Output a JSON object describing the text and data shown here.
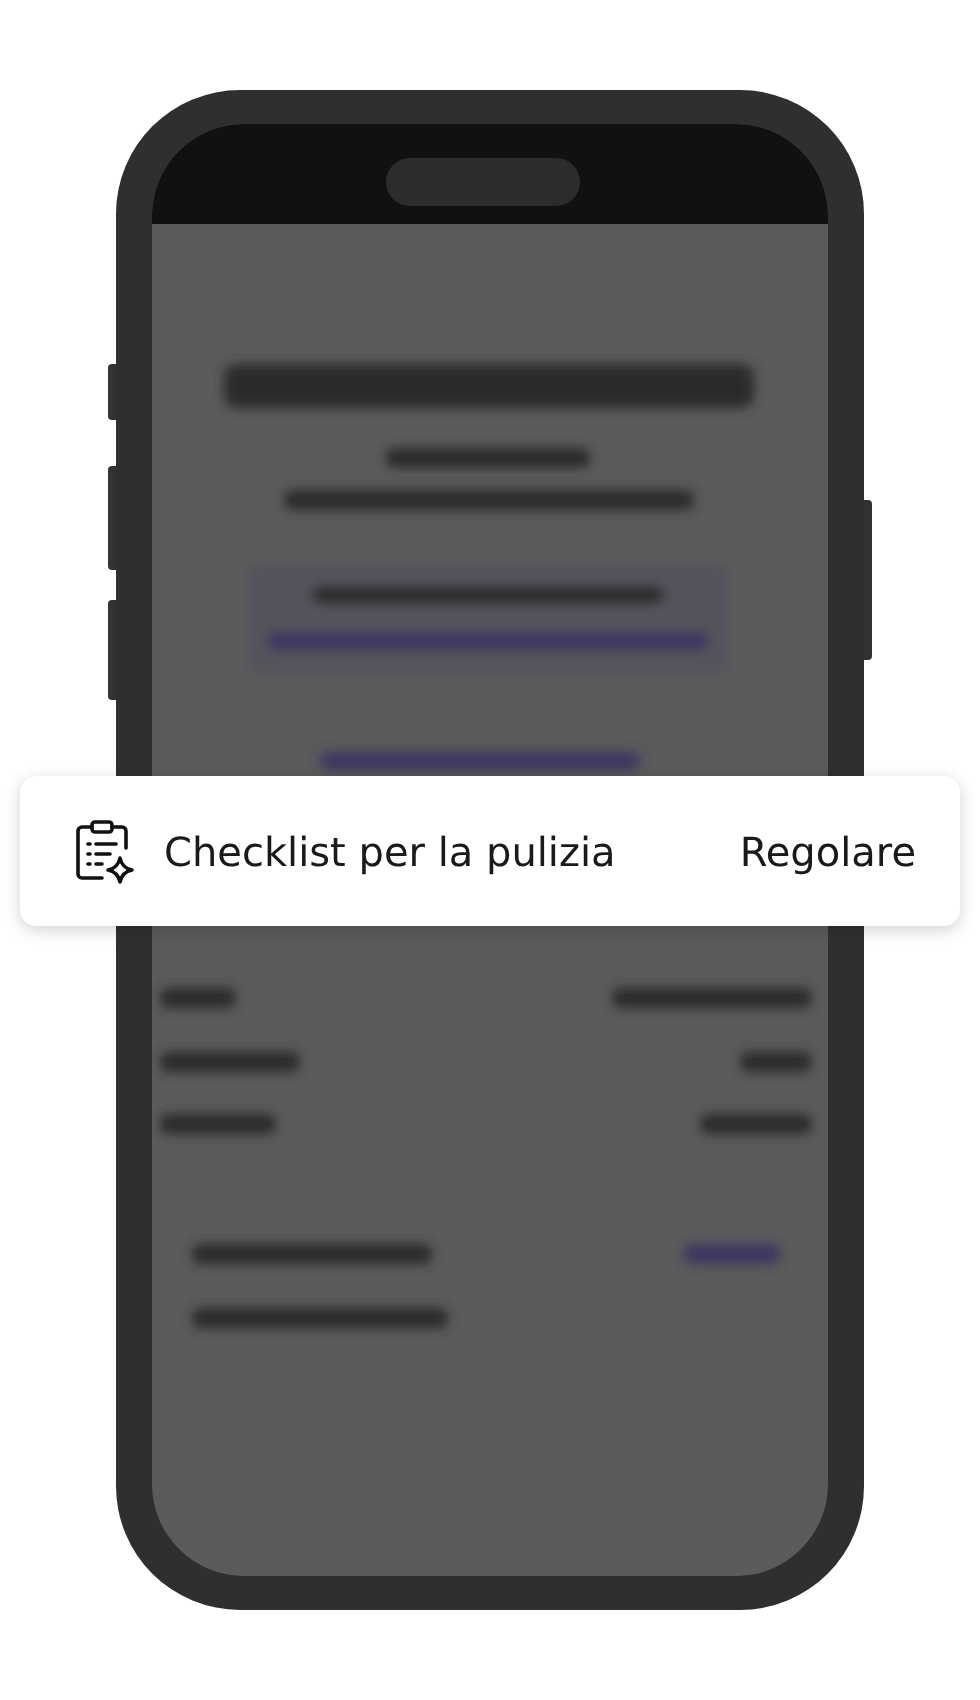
{
  "card": {
    "label": "Checklist per la pulizia",
    "action": "Regolare"
  }
}
